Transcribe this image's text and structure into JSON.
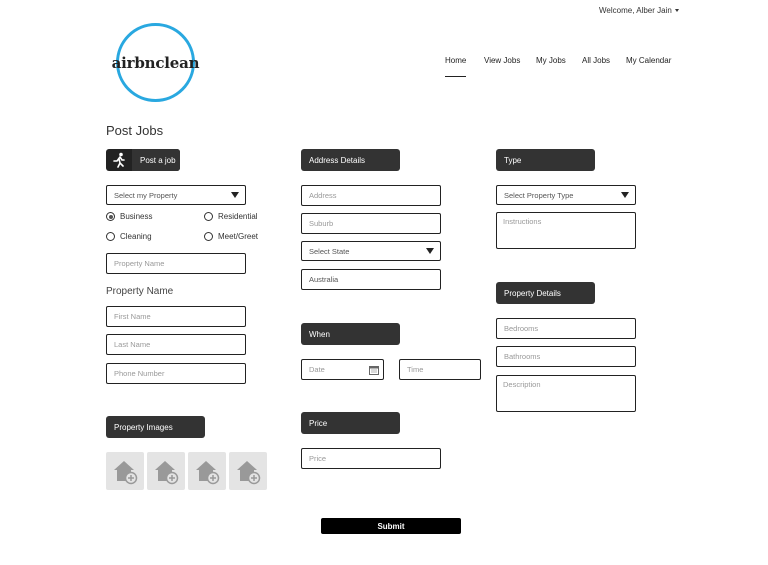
{
  "header": {
    "welcome": "Welcome, Alber Jain",
    "logo_text": "airbnclean",
    "nav": [
      "Home",
      "View Jobs",
      "My Jobs",
      "All Jobs",
      "My Calendar"
    ]
  },
  "page_title": "Post Jobs",
  "left": {
    "post_job_label": "Post a job",
    "select_property": "Select my Property",
    "radios": [
      {
        "label": "Business",
        "selected": true
      },
      {
        "label": "Residential",
        "selected": false
      },
      {
        "label": "Cleaning",
        "selected": false
      },
      {
        "label": "Meet/Greet",
        "selected": false
      }
    ],
    "property_name_placeholder": "Property Name",
    "property_name_heading": "Property Name",
    "first_name_placeholder": "First Name",
    "last_name_placeholder": "Last Name",
    "phone_placeholder": "Phone Number",
    "property_images_label": "Property Images"
  },
  "middle": {
    "address_details_label": "Address Details",
    "address_placeholder": "Address",
    "suburb_placeholder": "Suburb",
    "select_state": "Select State",
    "country_value": "Australia",
    "when_label": "When",
    "date_placeholder": "Date",
    "time_placeholder": "Time",
    "price_label": "Price",
    "price_placeholder": "Price"
  },
  "right": {
    "type_label": "Type",
    "select_property_type": "Select Property Type",
    "instructions_placeholder": "Instructions",
    "property_details_label": "Property Details",
    "bedrooms_placeholder": "Bedrooms",
    "bathrooms_placeholder": "Bathrooms",
    "description_placeholder": "Description"
  },
  "submit_label": "Submit",
  "colors": {
    "logo_ring": "#29a8e0",
    "header_bar": "#333333",
    "submit_bg": "#000000"
  }
}
